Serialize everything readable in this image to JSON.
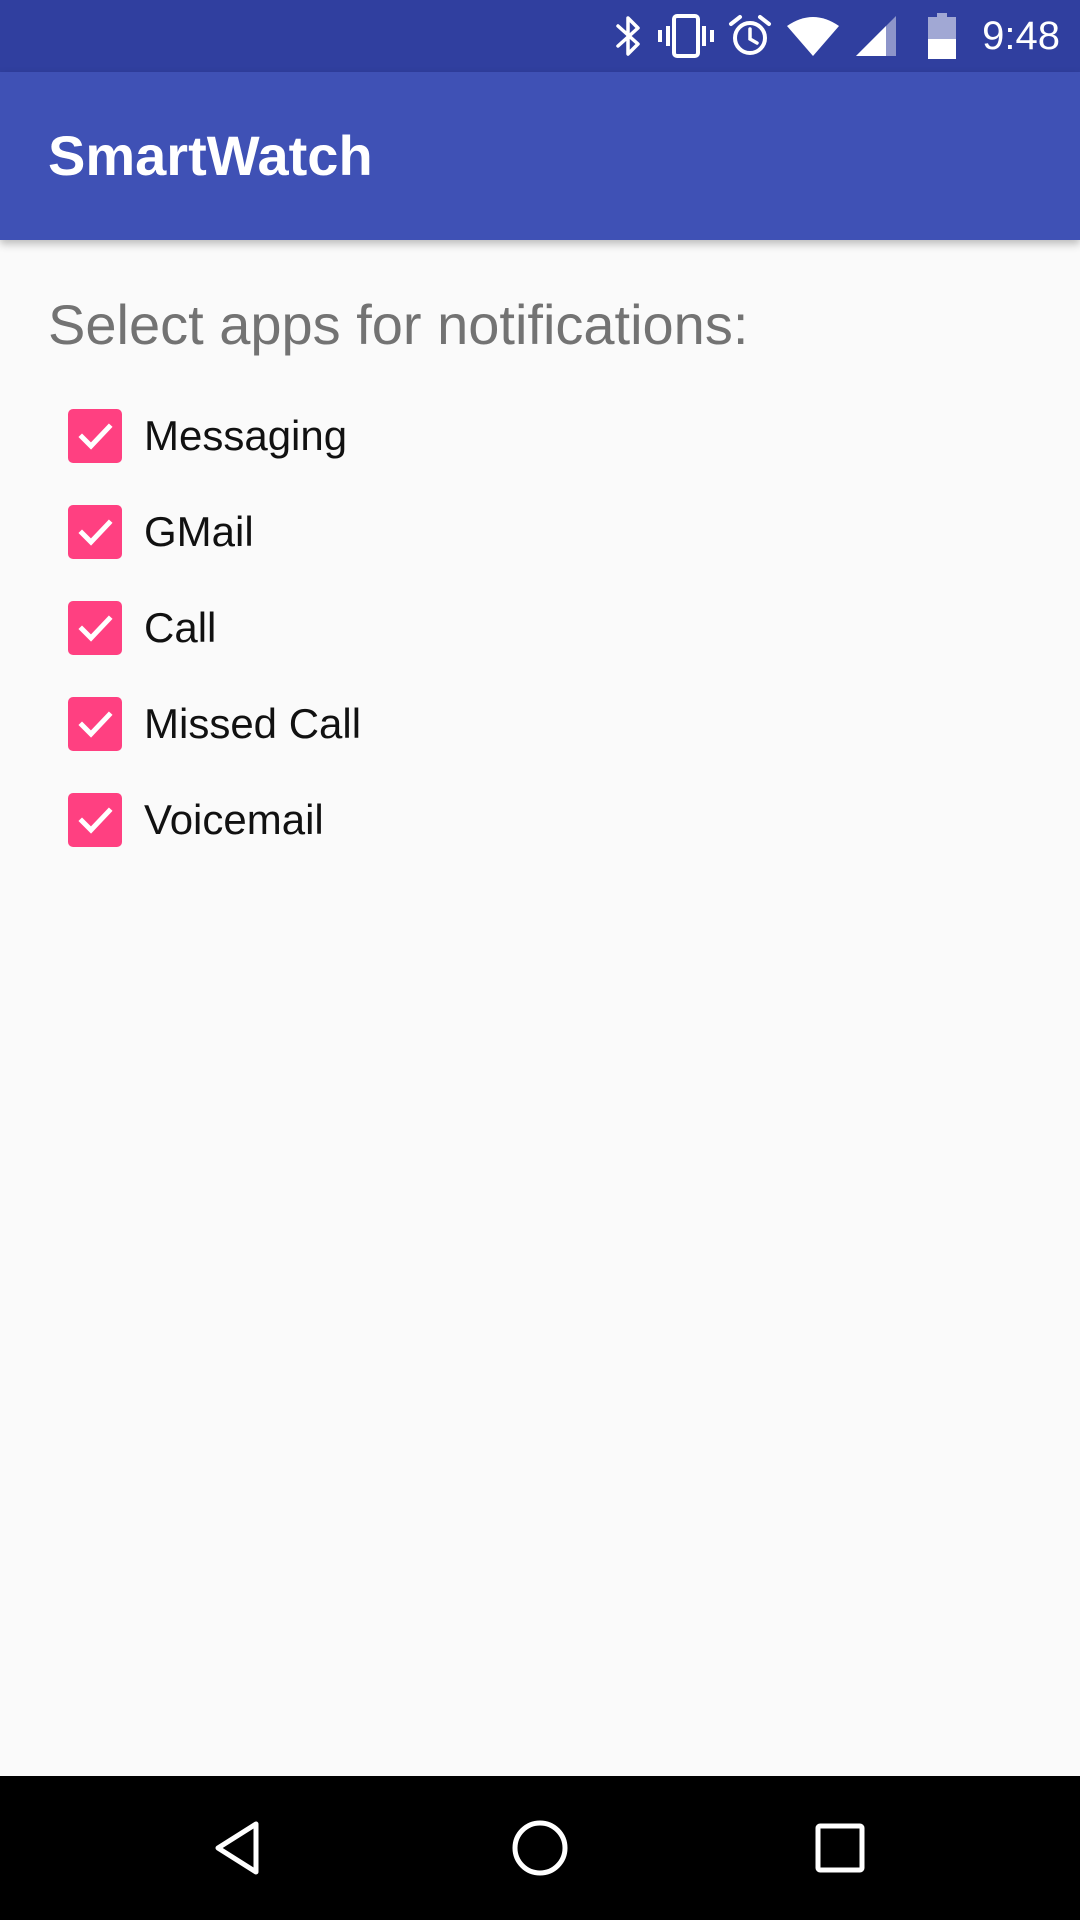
{
  "status_bar": {
    "time": "9:48",
    "icons": [
      "bluetooth-icon",
      "vibrate-icon",
      "alarm-icon",
      "wifi-icon",
      "cell-signal-icon",
      "battery-icon"
    ],
    "background_color": "#303f9f"
  },
  "app_bar": {
    "title": "SmartWatch",
    "background_color": "#3f51b5"
  },
  "main": {
    "prompt": "Select apps for notifications:",
    "options": [
      {
        "label": "Messaging",
        "checked": true
      },
      {
        "label": "GMail",
        "checked": true
      },
      {
        "label": "Call",
        "checked": true
      },
      {
        "label": "Missed Call",
        "checked": true
      },
      {
        "label": "Voicemail",
        "checked": true
      }
    ],
    "checkbox_color": "#ff4081"
  },
  "nav_bar": {
    "buttons": [
      "back-icon",
      "home-icon",
      "recents-icon"
    ]
  }
}
